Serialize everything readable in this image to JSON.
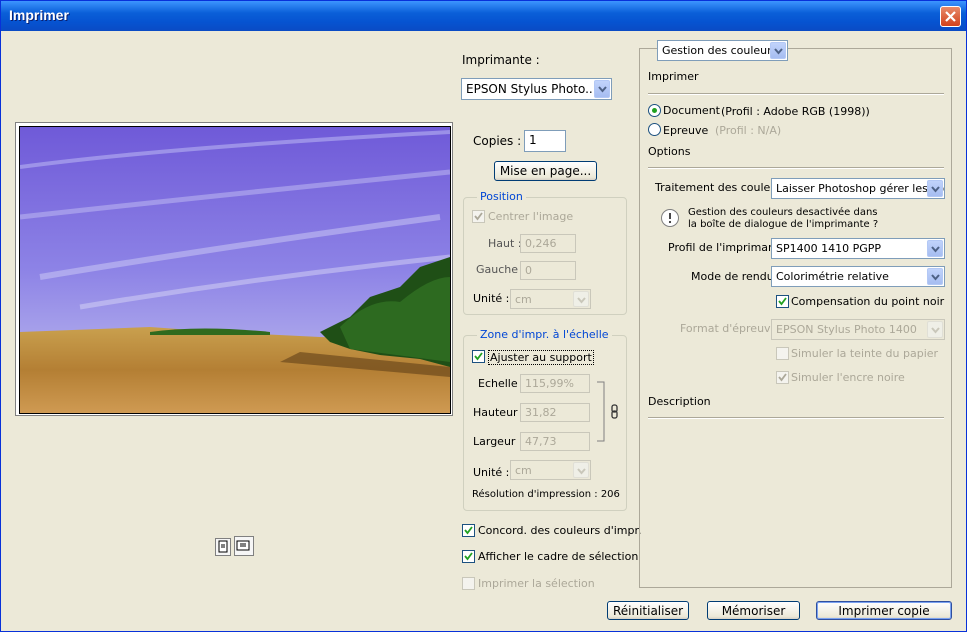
{
  "window": {
    "title": "Imprimer"
  },
  "printer": {
    "label": "Imprimante :",
    "value": "EPSON Stylus Photo..."
  },
  "copies": {
    "label": "Copies :",
    "value": "1"
  },
  "page_setup_button": "Mise en page...",
  "position": {
    "title": "Position",
    "center_label": "Centrer l'image",
    "top_label": "Haut :",
    "top_value": "0,246",
    "left_label": "Gauche :",
    "left_value": "0",
    "unit_label": "Unité :",
    "unit_value": "cm"
  },
  "scaled": {
    "title": "Zone d'impr. à l'échelle",
    "fit_label": "Ajuster au support",
    "scale_label": "Echelle :",
    "scale_value": "115,99%",
    "height_label": "Hauteur :",
    "height_value": "31,82",
    "width_label": "Largeur :",
    "width_value": "47,73",
    "unit_label": "Unité :",
    "unit_value": "cm",
    "resolution_label": "Résolution d'impression : 206"
  },
  "options_left": {
    "match_colors": "Concord. des couleurs d'impr.",
    "show_bbox": "Afficher le cadre de sélection",
    "print_selection": "Imprimer la sélection"
  },
  "right_panel": {
    "mode_select": "Gestion des couleurs",
    "print_heading": "Imprimer",
    "document_label": "Document",
    "document_profile": "(Profil : Adobe RGB (1998))",
    "proof_label": "Epreuve",
    "proof_profile": "(Profil : N/A)",
    "options_heading": "Options",
    "color_handling_label": "Traitement des couleurs :",
    "color_handling_value": "Laisser Photoshop gérer les co...",
    "warning_line1": "Gestion des couleurs desactivée dans",
    "warning_line2": "la boîte de dialogue de l'imprimante ?",
    "printer_profile_label": "Profil de l'imprimante :",
    "printer_profile_value": "SP1400 1410 PGPP",
    "rendering_label": "Mode de rendu :",
    "rendering_value": "Colorimétrie relative",
    "black_point_label": "Compensation du point noir",
    "proof_setup_label": "Format d'épreuve :",
    "proof_setup_value": "EPSON Stylus Photo 1400",
    "simulate_paper": "Simuler la teinte du papier",
    "simulate_ink": "Simuler l'encre noire",
    "description_heading": "Description"
  },
  "buttons": {
    "reset": "Réinitialiser",
    "remember": "Mémoriser",
    "print_one": "Imprimer copie"
  },
  "colors": {
    "titlebar": "#0a5fd8",
    "group_title": "#0046d5",
    "face": "#ece9d8"
  }
}
